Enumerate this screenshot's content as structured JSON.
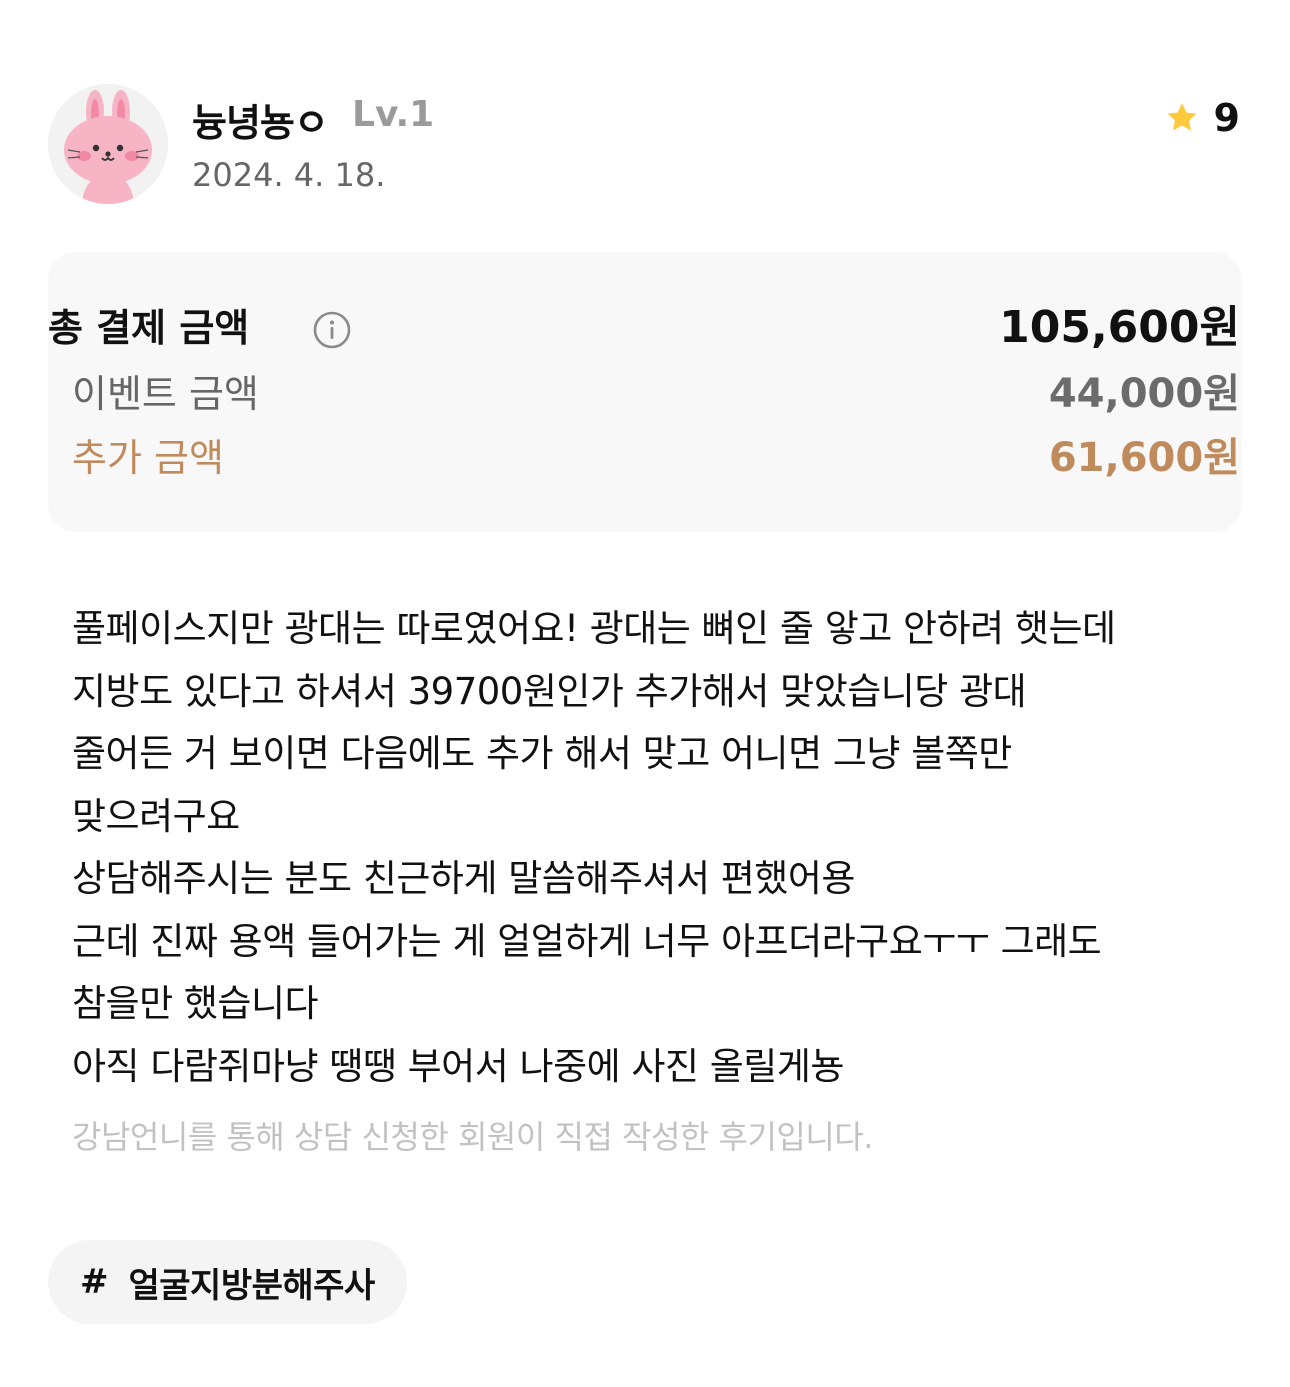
{
  "user": {
    "name": "늉녕뇽ㅇ",
    "level": "Lv.1",
    "date": "2024. 4. 18.",
    "avatar_icon": "bunny-avatar-icon"
  },
  "rating": {
    "icon": "star-icon",
    "value": "9",
    "star_color": "#FFC93C"
  },
  "price": {
    "total_label": "총 결제 금액",
    "total_value": "105,600원",
    "event_label": "이벤트 금액",
    "event_value": "44,000원",
    "extra_label": "추가 금액",
    "extra_value": "61,600원",
    "accent_color": "#C08B5C"
  },
  "review": {
    "lines": [
      "풀페이스지만 광대는 따로였어요! 광대는 뼈인 줄 앟고 안하려 햇는데",
      "지방도 있다고 하셔서 39700원인가 추가해서 맞았습니당 광대",
      "줄어든 거 보이면 다음에도 추가 해서 맞고 어니면 그냥 볼쪽만",
      "맞으려구요",
      "상담해주시는 분도 친근하게 말씀해주셔서 편했어용",
      "근데 진짜 용액 들어가는 게 얼얼하게 너무 아프더라구요ㅜㅜ 그래도",
      "참을만 했습니다",
      "아직 다람쥐마냥 땡땡 부어서 나중에 사진 올릴게뇽"
    ],
    "disclaimer": "강남언니를 통해 상담 신청한 회원이 직접 작성한 후기입니다."
  },
  "tags": [
    {
      "hash": "#",
      "label": "얼굴지방분해주사"
    }
  ]
}
